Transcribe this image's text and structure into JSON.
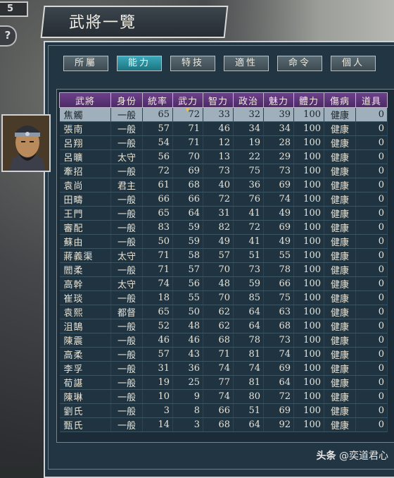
{
  "counter": "5",
  "help_label": "?",
  "title": "武將一覽",
  "tabs": [
    {
      "label": "所屬",
      "active": false
    },
    {
      "label": "能力",
      "active": true
    },
    {
      "label": "特技",
      "active": false
    },
    {
      "label": "適性",
      "active": false
    },
    {
      "label": "命令",
      "active": false
    },
    {
      "label": "個人",
      "active": false
    }
  ],
  "columns": [
    "武將",
    "身份",
    "統率",
    "武力",
    "智力",
    "政治",
    "魅力",
    "體力",
    "傷病",
    "道具"
  ],
  "sorted_column": "武力",
  "rows": [
    [
      "焦觸",
      "一般",
      "65",
      "72",
      "33",
      "32",
      "39",
      "100",
      "健康",
      "0"
    ],
    [
      "張南",
      "一般",
      "57",
      "71",
      "46",
      "34",
      "34",
      "100",
      "健康",
      "0"
    ],
    [
      "呂翔",
      "一般",
      "54",
      "71",
      "12",
      "19",
      "28",
      "100",
      "健康",
      "0"
    ],
    [
      "呂曠",
      "太守",
      "56",
      "70",
      "13",
      "22",
      "29",
      "100",
      "健康",
      "0"
    ],
    [
      "牽招",
      "一般",
      "72",
      "69",
      "73",
      "75",
      "73",
      "100",
      "健康",
      "0"
    ],
    [
      "袁尚",
      "君主",
      "61",
      "68",
      "40",
      "36",
      "69",
      "100",
      "健康",
      "0"
    ],
    [
      "田疇",
      "一般",
      "66",
      "66",
      "72",
      "76",
      "74",
      "100",
      "健康",
      "0"
    ],
    [
      "王門",
      "一般",
      "65",
      "64",
      "31",
      "41",
      "49",
      "100",
      "健康",
      "0"
    ],
    [
      "審配",
      "一般",
      "83",
      "59",
      "82",
      "72",
      "69",
      "100",
      "健康",
      "0"
    ],
    [
      "蘇由",
      "一般",
      "50",
      "59",
      "49",
      "41",
      "49",
      "100",
      "健康",
      "0"
    ],
    [
      "蔣義渠",
      "太守",
      "71",
      "58",
      "57",
      "51",
      "55",
      "100",
      "健康",
      "0"
    ],
    [
      "閻柔",
      "一般",
      "71",
      "57",
      "70",
      "73",
      "78",
      "100",
      "健康",
      "0"
    ],
    [
      "高幹",
      "太守",
      "74",
      "56",
      "48",
      "59",
      "66",
      "100",
      "健康",
      "0"
    ],
    [
      "崔琰",
      "一般",
      "18",
      "55",
      "70",
      "85",
      "75",
      "100",
      "健康",
      "0"
    ],
    [
      "袁熙",
      "都督",
      "65",
      "50",
      "62",
      "64",
      "63",
      "100",
      "健康",
      "0"
    ],
    [
      "沮鵠",
      "一般",
      "52",
      "48",
      "62",
      "64",
      "68",
      "100",
      "健康",
      "0"
    ],
    [
      "陳震",
      "一般",
      "46",
      "46",
      "68",
      "78",
      "73",
      "100",
      "健康",
      "0"
    ],
    [
      "高柔",
      "一般",
      "57",
      "43",
      "71",
      "81",
      "74",
      "100",
      "健康",
      "0"
    ],
    [
      "李孚",
      "一般",
      "31",
      "36",
      "74",
      "74",
      "69",
      "100",
      "健康",
      "0"
    ],
    [
      "荀諶",
      "一般",
      "19",
      "25",
      "77",
      "81",
      "64",
      "100",
      "健康",
      "0"
    ],
    [
      "陳琳",
      "一般",
      "10",
      "9",
      "74",
      "80",
      "72",
      "100",
      "健康",
      "0"
    ],
    [
      "劉氏",
      "一般",
      "3",
      "8",
      "66",
      "51",
      "69",
      "100",
      "健康",
      "0"
    ],
    [
      "甄氏",
      "一般",
      "14",
      "3",
      "68",
      "64",
      "92",
      "100",
      "健康",
      "0"
    ]
  ],
  "selected_row": 0,
  "watermark": {
    "head": "头条",
    "handle": "@奕道君心"
  },
  "colors": {
    "panel": "#223542",
    "header": "#5b3478",
    "active_tab": "#2a8d9c",
    "selected_row": "#9fb0bc"
  }
}
